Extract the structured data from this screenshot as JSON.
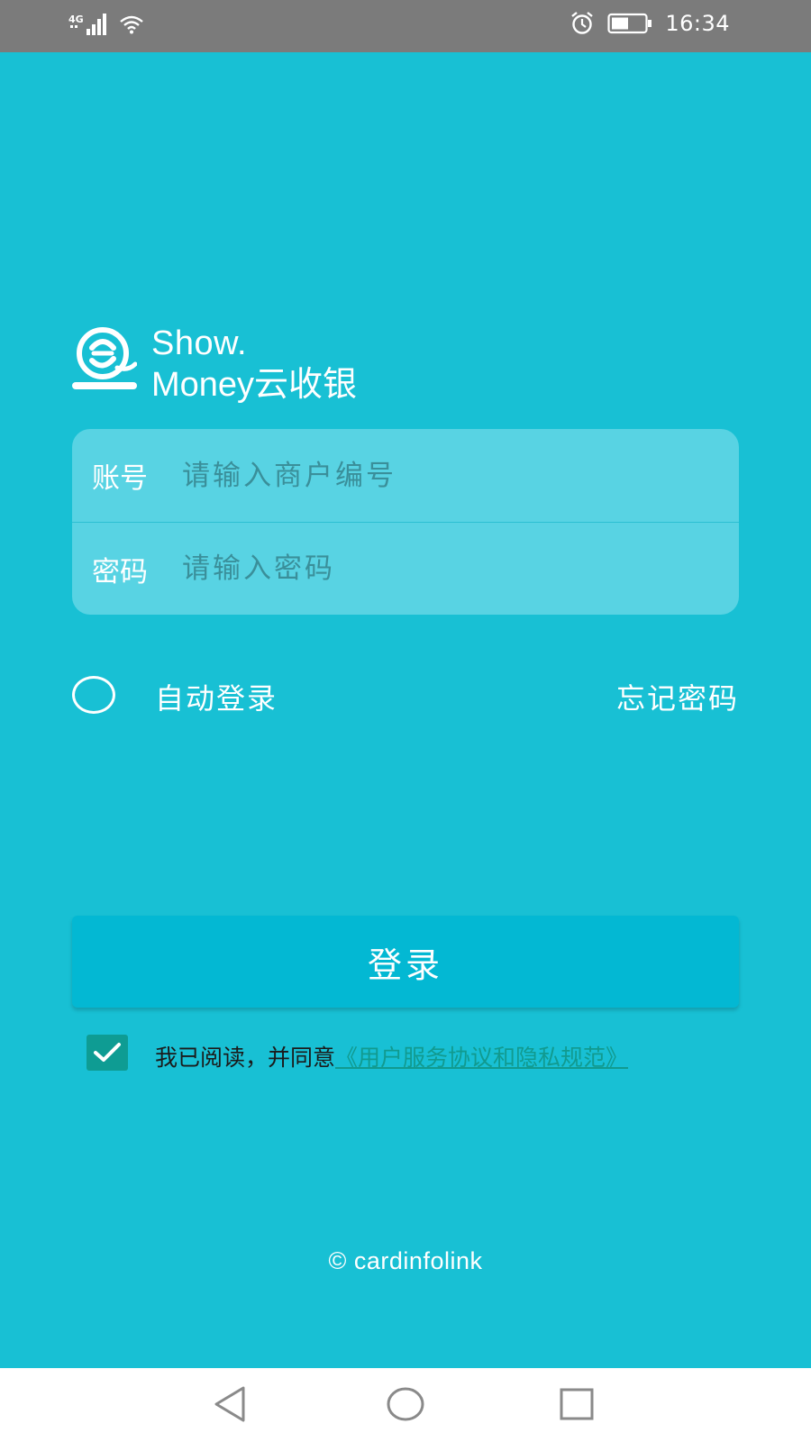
{
  "status_bar": {
    "network": "4G",
    "time": "16:34",
    "icons": [
      "signal-icon",
      "wifi-icon",
      "alarm-icon",
      "battery-icon"
    ]
  },
  "logo": {
    "line1": "Show.",
    "line2": "Money云收银"
  },
  "login_form": {
    "account": {
      "label": "账号",
      "placeholder": "请输入商户编号",
      "value": ""
    },
    "password": {
      "label": "密码",
      "placeholder": "请输入密码",
      "value": ""
    }
  },
  "options": {
    "auto_login_label": "自动登录",
    "auto_login_checked": false,
    "forgot_password_label": "忘记密码"
  },
  "login_button_label": "登录",
  "agreement": {
    "checked": true,
    "text": "我已阅读，并同意",
    "link_text": "《用户服务协议和隐私规范》"
  },
  "copyright": "© cardinfolink",
  "colors": {
    "background": "#18c0d4",
    "card": "#58d3e3",
    "button": "#03b8d3",
    "checkbox": "#0e9c93",
    "link": "#119a8f",
    "status_bar": "#7b7b7b"
  },
  "nav_bar": {
    "icons": [
      "back-icon",
      "home-icon",
      "recent-apps-icon"
    ]
  }
}
